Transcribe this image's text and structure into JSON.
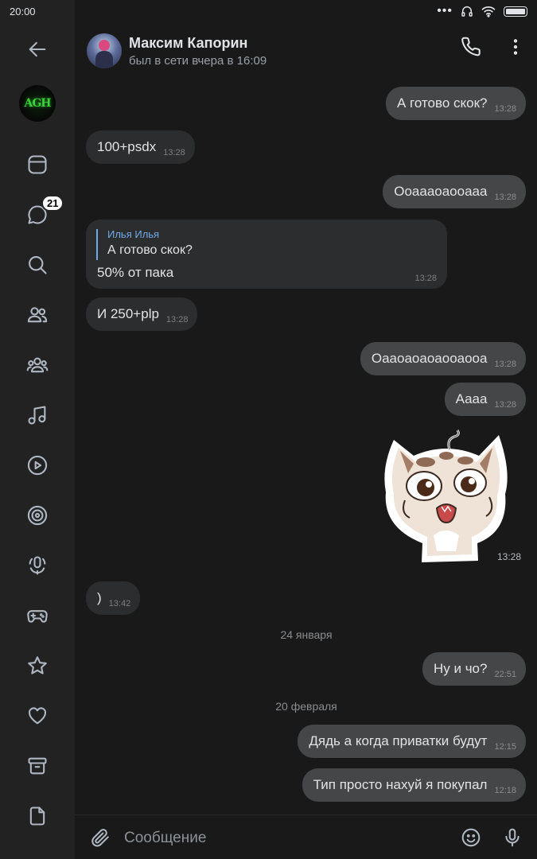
{
  "status_bar": {
    "time": "20:00",
    "dots": "•••"
  },
  "sidebar": {
    "avatar_text": "AGH",
    "badge": "21",
    "icons": [
      "back-arrow-icon",
      "newsfeed-icon",
      "messages-icon",
      "search-icon",
      "friends-icon",
      "communities-icon",
      "music-icon",
      "video-icon",
      "clips-icon",
      "podcasts-icon",
      "games-icon",
      "bookmarks-icon",
      "likes-icon",
      "archive-icon",
      "documents-icon"
    ]
  },
  "header": {
    "name": "Максим Капорин",
    "status": "был в сети вчера в 16:09"
  },
  "messages": [
    {
      "dir": "out",
      "text": "А готово скок?",
      "time": "13:28"
    },
    {
      "dir": "in",
      "text": "100+psdx",
      "time": "13:28"
    },
    {
      "dir": "out",
      "text": "Ооаааоаооааа",
      "time": "13:28"
    },
    {
      "dir": "in",
      "reply_author": "Илья Илья",
      "reply_text": "А готово скок?",
      "text": "50% от пака",
      "time": "13:28"
    },
    {
      "dir": "in",
      "text": "И 250+plp",
      "time": "13:28"
    },
    {
      "dir": "out",
      "text": "Оааоаоаоаооаооа",
      "time": "13:28"
    },
    {
      "dir": "out",
      "text": "Аааа",
      "time": "13:28"
    },
    {
      "dir": "out",
      "sticker": "crying-cat-sticker",
      "time": "13:28"
    },
    {
      "dir": "in",
      "text": ")",
      "time": "13:42"
    },
    {
      "date": "24 января"
    },
    {
      "dir": "out",
      "text": "Ну и чо?",
      "time": "22:51"
    },
    {
      "date": "20 февраля"
    },
    {
      "dir": "out",
      "text": "Дядь а когда приватки будут",
      "time": "12:15"
    },
    {
      "dir": "out",
      "text": "Тип просто нахуй я покупал",
      "time": "12:18"
    }
  ],
  "composer": {
    "placeholder": "Сообщение"
  },
  "colors": {
    "background": "#191919",
    "sidebar": "#222222",
    "bubble_in": "#2c2d2e",
    "bubble_out": "#454647",
    "accent": "#71aaeb"
  }
}
